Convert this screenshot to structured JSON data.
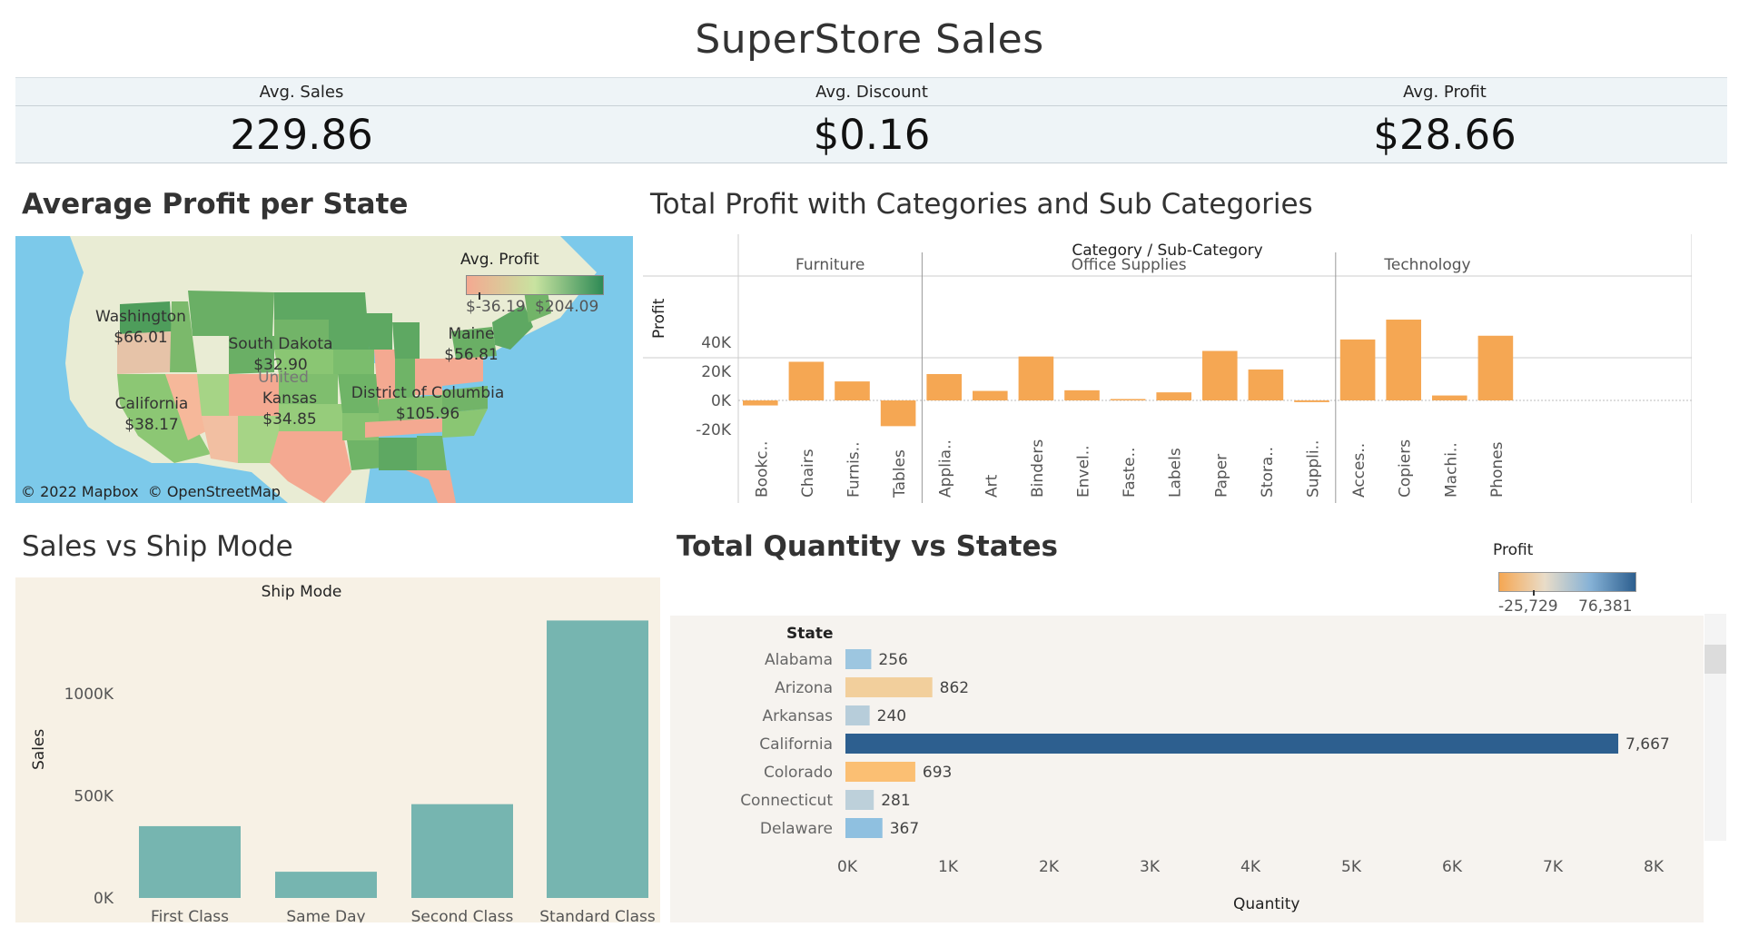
{
  "title": "SuperStore Sales",
  "kpis": [
    {
      "label": "Avg. Sales",
      "value": "229.86"
    },
    {
      "label": "Avg. Discount",
      "value": "$0.16"
    },
    {
      "label": "Avg. Profit",
      "value": "$28.66"
    }
  ],
  "map_panel": {
    "title": "Average Profit per State",
    "legend_title": "Avg. Profit",
    "legend_min": "$-36.19",
    "legend_max": "$204.09",
    "attribution_mapbox": "© 2022 Mapbox",
    "attribution_osm": "© OpenStreetMap",
    "labels": [
      {
        "name": "Washington",
        "value": "$66.01"
      },
      {
        "name": "South Dakota",
        "value": "$32.90"
      },
      {
        "name": "United",
        "value": ""
      },
      {
        "name": "Kansas",
        "value": "$34.85"
      },
      {
        "name": "California",
        "value": "$38.17"
      },
      {
        "name": "Maine",
        "value": "$56.81"
      },
      {
        "name": "District of Columbia",
        "value": "$105.96"
      }
    ],
    "colors": {
      "water": "#7cc9ea",
      "land": "#e9ecd4",
      "neg": "#f4a991",
      "pos": "#2e8a55"
    }
  },
  "category_panel": {
    "title": "Total Profit with Categories and Sub Categories",
    "header": "Category / Sub-Category",
    "y_axis_label": "Profit",
    "y_ticks": [
      "40K",
      "20K",
      "0K",
      "-20K"
    ],
    "bar_color": "#f5a753"
  },
  "ship_panel": {
    "title": "Sales vs Ship Mode",
    "header": "Ship Mode",
    "y_axis_label": "Sales",
    "y_ticks": [
      "1000K",
      "500K",
      "0K"
    ],
    "bar_color": "#76b5b0"
  },
  "qty_panel": {
    "title": "Total Quantity vs States",
    "legend_title": "Profit",
    "legend_min": "-25,729",
    "legend_max": "76,381",
    "row_header": "State",
    "x_axis_label": "Quantity",
    "x_ticks": [
      "0K",
      "1K",
      "2K",
      "3K",
      "4K",
      "5K",
      "6K",
      "7K",
      "8K"
    ]
  },
  "chart_data": [
    {
      "type": "bar",
      "title": "Total Profit with Categories and Sub Categories",
      "ylabel": "Profit",
      "ylim": [
        -25000,
        65000
      ],
      "groups": [
        {
          "name": "Furniture",
          "categories": [
            "Bookc..",
            "Chairs",
            "Furnis..",
            "Tables"
          ],
          "values": [
            -3473,
            26590,
            13059,
            -17725
          ]
        },
        {
          "name": "Office Supplies",
          "categories": [
            "Applia..",
            "Art",
            "Binders",
            "Envel..",
            "Faste..",
            "Labels",
            "Paper",
            "Stora..",
            "Suppli.."
          ],
          "values": [
            18138,
            6528,
            30222,
            6964,
            950,
            5546,
            34054,
            21279,
            -1189
          ]
        },
        {
          "name": "Technology",
          "categories": [
            "Acces..",
            "Copiers",
            "Machi..",
            "Phones"
          ],
          "values": [
            41937,
            55618,
            3385,
            44516
          ]
        }
      ]
    },
    {
      "type": "bar",
      "title": "Sales vs Ship Mode",
      "ylabel": "Sales",
      "ylim": [
        0,
        1400000
      ],
      "categories": [
        "First Class",
        "Same Day",
        "Second Class",
        "Standard Class"
      ],
      "values": [
        351428,
        128363,
        459194,
        1358216
      ]
    },
    {
      "type": "bar",
      "title": "Total Quantity vs States",
      "xlabel": "Quantity",
      "xlim": [
        0,
        8000
      ],
      "categories": [
        "Alabama",
        "Arizona",
        "Arkansas",
        "California",
        "Colorado",
        "Connecticut",
        "Delaware"
      ],
      "values": [
        256,
        862,
        240,
        7667,
        693,
        281,
        367
      ],
      "value_labels": [
        "256",
        "862",
        "240",
        "7,667",
        "693",
        "281",
        "367"
      ],
      "colors": [
        "#9dc6e0",
        "#f2cf9c",
        "#b7cdda",
        "#2d5f8f",
        "#fbbf73",
        "#bdd0da",
        "#8fc0e0"
      ]
    }
  ]
}
